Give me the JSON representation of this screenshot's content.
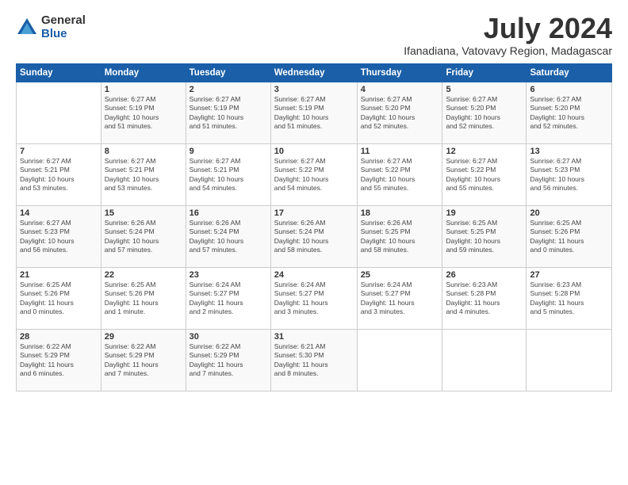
{
  "logo": {
    "general": "General",
    "blue": "Blue"
  },
  "title": "July 2024",
  "subtitle": "Ifanadiana, Vatovavy Region, Madagascar",
  "headers": [
    "Sunday",
    "Monday",
    "Tuesday",
    "Wednesday",
    "Thursday",
    "Friday",
    "Saturday"
  ],
  "weeks": [
    [
      {
        "num": "",
        "detail": ""
      },
      {
        "num": "1",
        "detail": "Sunrise: 6:27 AM\nSunset: 5:19 PM\nDaylight: 10 hours\nand 51 minutes."
      },
      {
        "num": "2",
        "detail": "Sunrise: 6:27 AM\nSunset: 5:19 PM\nDaylight: 10 hours\nand 51 minutes."
      },
      {
        "num": "3",
        "detail": "Sunrise: 6:27 AM\nSunset: 5:19 PM\nDaylight: 10 hours\nand 51 minutes."
      },
      {
        "num": "4",
        "detail": "Sunrise: 6:27 AM\nSunset: 5:20 PM\nDaylight: 10 hours\nand 52 minutes."
      },
      {
        "num": "5",
        "detail": "Sunrise: 6:27 AM\nSunset: 5:20 PM\nDaylight: 10 hours\nand 52 minutes."
      },
      {
        "num": "6",
        "detail": "Sunrise: 6:27 AM\nSunset: 5:20 PM\nDaylight: 10 hours\nand 52 minutes."
      }
    ],
    [
      {
        "num": "7",
        "detail": "Sunrise: 6:27 AM\nSunset: 5:21 PM\nDaylight: 10 hours\nand 53 minutes."
      },
      {
        "num": "8",
        "detail": "Sunrise: 6:27 AM\nSunset: 5:21 PM\nDaylight: 10 hours\nand 53 minutes."
      },
      {
        "num": "9",
        "detail": "Sunrise: 6:27 AM\nSunset: 5:21 PM\nDaylight: 10 hours\nand 54 minutes."
      },
      {
        "num": "10",
        "detail": "Sunrise: 6:27 AM\nSunset: 5:22 PM\nDaylight: 10 hours\nand 54 minutes."
      },
      {
        "num": "11",
        "detail": "Sunrise: 6:27 AM\nSunset: 5:22 PM\nDaylight: 10 hours\nand 55 minutes."
      },
      {
        "num": "12",
        "detail": "Sunrise: 6:27 AM\nSunset: 5:22 PM\nDaylight: 10 hours\nand 55 minutes."
      },
      {
        "num": "13",
        "detail": "Sunrise: 6:27 AM\nSunset: 5:23 PM\nDaylight: 10 hours\nand 56 minutes."
      }
    ],
    [
      {
        "num": "14",
        "detail": "Sunrise: 6:27 AM\nSunset: 5:23 PM\nDaylight: 10 hours\nand 56 minutes."
      },
      {
        "num": "15",
        "detail": "Sunrise: 6:26 AM\nSunset: 5:24 PM\nDaylight: 10 hours\nand 57 minutes."
      },
      {
        "num": "16",
        "detail": "Sunrise: 6:26 AM\nSunset: 5:24 PM\nDaylight: 10 hours\nand 57 minutes."
      },
      {
        "num": "17",
        "detail": "Sunrise: 6:26 AM\nSunset: 5:24 PM\nDaylight: 10 hours\nand 58 minutes."
      },
      {
        "num": "18",
        "detail": "Sunrise: 6:26 AM\nSunset: 5:25 PM\nDaylight: 10 hours\nand 58 minutes."
      },
      {
        "num": "19",
        "detail": "Sunrise: 6:25 AM\nSunset: 5:25 PM\nDaylight: 10 hours\nand 59 minutes."
      },
      {
        "num": "20",
        "detail": "Sunrise: 6:25 AM\nSunset: 5:26 PM\nDaylight: 11 hours\nand 0 minutes."
      }
    ],
    [
      {
        "num": "21",
        "detail": "Sunrise: 6:25 AM\nSunset: 5:26 PM\nDaylight: 11 hours\nand 0 minutes."
      },
      {
        "num": "22",
        "detail": "Sunrise: 6:25 AM\nSunset: 5:26 PM\nDaylight: 11 hours\nand 1 minute."
      },
      {
        "num": "23",
        "detail": "Sunrise: 6:24 AM\nSunset: 5:27 PM\nDaylight: 11 hours\nand 2 minutes."
      },
      {
        "num": "24",
        "detail": "Sunrise: 6:24 AM\nSunset: 5:27 PM\nDaylight: 11 hours\nand 3 minutes."
      },
      {
        "num": "25",
        "detail": "Sunrise: 6:24 AM\nSunset: 5:27 PM\nDaylight: 11 hours\nand 3 minutes."
      },
      {
        "num": "26",
        "detail": "Sunrise: 6:23 AM\nSunset: 5:28 PM\nDaylight: 11 hours\nand 4 minutes."
      },
      {
        "num": "27",
        "detail": "Sunrise: 6:23 AM\nSunset: 5:28 PM\nDaylight: 11 hours\nand 5 minutes."
      }
    ],
    [
      {
        "num": "28",
        "detail": "Sunrise: 6:22 AM\nSunset: 5:29 PM\nDaylight: 11 hours\nand 6 minutes."
      },
      {
        "num": "29",
        "detail": "Sunrise: 6:22 AM\nSunset: 5:29 PM\nDaylight: 11 hours\nand 7 minutes."
      },
      {
        "num": "30",
        "detail": "Sunrise: 6:22 AM\nSunset: 5:29 PM\nDaylight: 11 hours\nand 7 minutes."
      },
      {
        "num": "31",
        "detail": "Sunrise: 6:21 AM\nSunset: 5:30 PM\nDaylight: 11 hours\nand 8 minutes."
      },
      {
        "num": "",
        "detail": ""
      },
      {
        "num": "",
        "detail": ""
      },
      {
        "num": "",
        "detail": ""
      }
    ]
  ]
}
